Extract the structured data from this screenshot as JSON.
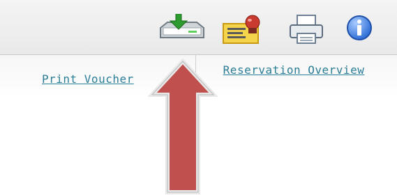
{
  "toolbar": {
    "icons": [
      {
        "name": "download-icon",
        "color": "#2e9b2e"
      },
      {
        "name": "voucher-stamp-icon",
        "color": "#e6c02a"
      },
      {
        "name": "printer-icon",
        "color": "#6d7f93"
      },
      {
        "name": "info-icon",
        "color": "#2f6fd6"
      }
    ]
  },
  "links": {
    "print_voucher": "Print Voucher",
    "reservation_overview": "Reservation Overview"
  },
  "annotation": {
    "arrow_color": "#c0504d",
    "arrow_outline": "#e8e8e8"
  }
}
